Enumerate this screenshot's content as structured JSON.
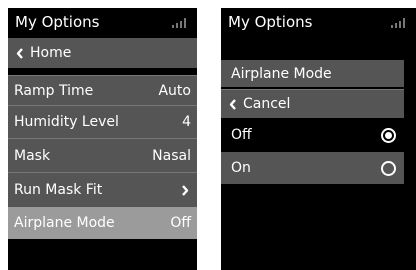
{
  "screens": [
    {
      "title": "My Options",
      "back_label": "Home",
      "items": [
        {
          "label": "Ramp Time",
          "value": "Auto"
        },
        {
          "label": "Humidity Level",
          "value": "4"
        },
        {
          "label": "Mask",
          "value": "Nasal"
        },
        {
          "label": "Run Mask Fit",
          "value": "",
          "icon": "chevron-right-icon"
        },
        {
          "label": "Airplane Mode",
          "value": "Off",
          "selected": true
        }
      ]
    },
    {
      "title": "My Options",
      "header": "Airplane Mode",
      "cancel_label": "Cancel",
      "options": [
        {
          "label": "Off",
          "checked": true
        },
        {
          "label": "On",
          "checked": false,
          "selected": true
        }
      ]
    }
  ],
  "icons": {
    "signal": "signal-strength-icon",
    "back": "chevron-left-icon",
    "next": "chevron-right-icon",
    "radio": "radio-button-icon"
  },
  "colors": {
    "background": "#000000",
    "row": "#555555",
    "selected_row": "#9b9b9b",
    "text": "#ffffff"
  }
}
